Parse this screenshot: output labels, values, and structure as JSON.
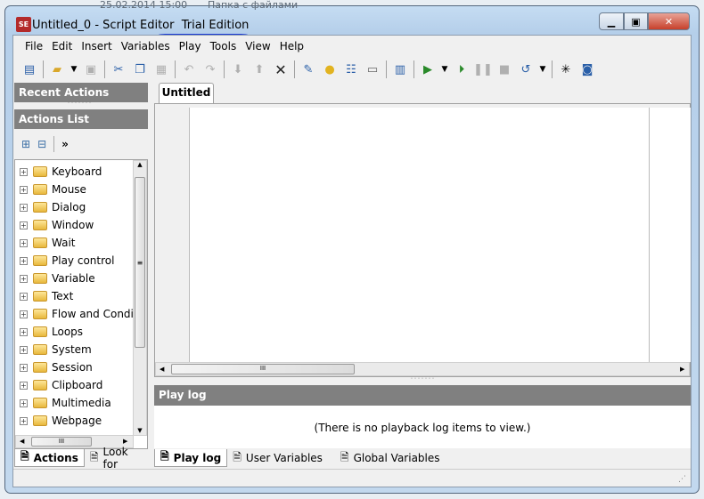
{
  "window": {
    "title": "Untitled_0 - Script Editor",
    "edition": "Trial Edition",
    "logo": "SE"
  },
  "desktop": {
    "date": "25.02.2014 15:00",
    "folder": "Папка с файлами"
  },
  "menu": [
    "File",
    "Edit",
    "Insert",
    "Variables",
    "Play",
    "Tools",
    "View",
    "Help"
  ],
  "left": {
    "recent_title": "Recent Actions",
    "actions_title": "Actions List",
    "more": "»",
    "items": [
      "Keyboard",
      "Mouse",
      "Dialog",
      "Window",
      "Wait",
      "Play control",
      "Variable",
      "Text",
      "Flow and Conditi",
      "Loops",
      "System",
      "Session",
      "Clipboard",
      "Multimedia",
      "Webpage"
    ],
    "tabs": [
      "Actions",
      "Look for"
    ]
  },
  "editor": {
    "tab": "Untitled"
  },
  "playlog": {
    "title": "Play log",
    "empty": "(There is no playback log items to view.)",
    "tabs": [
      "Play log",
      "User Variables",
      "Global Variables"
    ]
  }
}
